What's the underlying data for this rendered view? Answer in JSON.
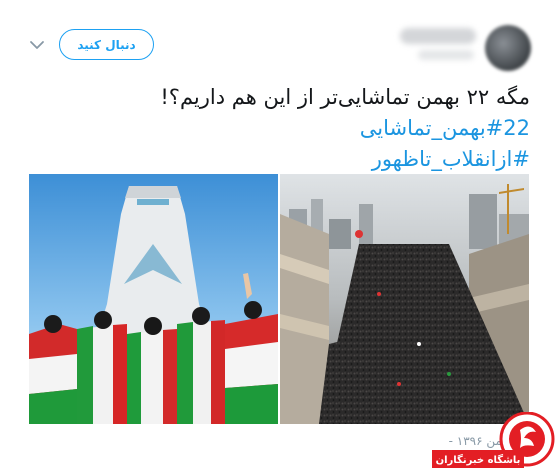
{
  "header": {
    "follow_label": "دنبال کنید",
    "author_name": "",
    "author_handle": ""
  },
  "tweet": {
    "text": "مگه ۲۲ بهمن تماشایی‌تر از این هم داریم؟!",
    "hashtags": [
      "#22بهمن_تماشایی",
      "#ازانقلاب_تاظهور"
    ],
    "date": "۲۲ بهمن ۱۳۹۶ -"
  },
  "media": {
    "left_image": "azadi-tower-flags-photo",
    "right_image": "rally-crowd-aerial-photo"
  },
  "watermark": {
    "text": "باشگاه خبرنگاران",
    "brand_color": "#e31e24"
  },
  "colors": {
    "accent": "#1da1f2",
    "hashtag": "#1b95e0",
    "text": "#14171a",
    "muted": "#8899a6"
  }
}
